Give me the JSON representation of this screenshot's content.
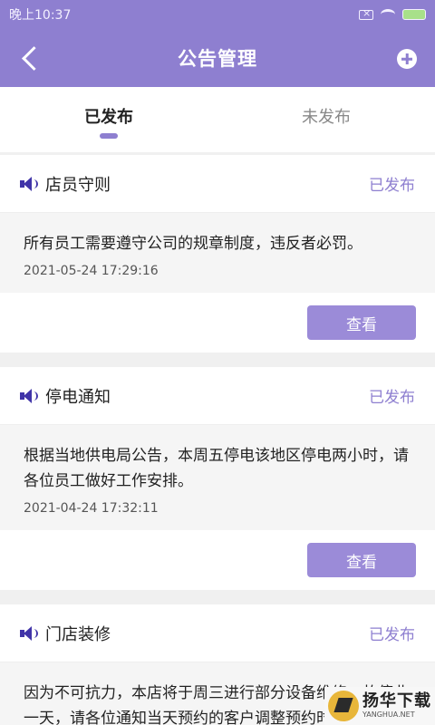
{
  "statusbar": {
    "time": "晚上10:37"
  },
  "navbar": {
    "title": "公告管理"
  },
  "tabs": [
    {
      "label": "已发布",
      "active": true
    },
    {
      "label": "未发布",
      "active": false
    }
  ],
  "notices": [
    {
      "title": "店员守则",
      "status": "已发布",
      "content": "所有员工需要遵守公司的规章制度，违反者必罚。",
      "date": "2021-05-24 17:29:16",
      "button": "查看"
    },
    {
      "title": "停电通知",
      "status": "已发布",
      "content": "根据当地供电局公告，本周五停电该地区停电两小时，请各位员工做好工作安排。",
      "date": "2021-04-24 17:32:11",
      "button": "查看"
    },
    {
      "title": "门店装修",
      "status": "已发布",
      "content": "因为不可抗力，本店将于周三进行部分设备维修，故停业一天，请各位通知当天预约的客户调整预约时间。",
      "date": "",
      "button": ""
    }
  ],
  "watermark": {
    "cn": "扬华下载",
    "en": "YANGHUA.NET"
  },
  "colors": {
    "accent": "#8e7fd0",
    "button": "#9b8bd8",
    "icon": "#4034a8"
  }
}
